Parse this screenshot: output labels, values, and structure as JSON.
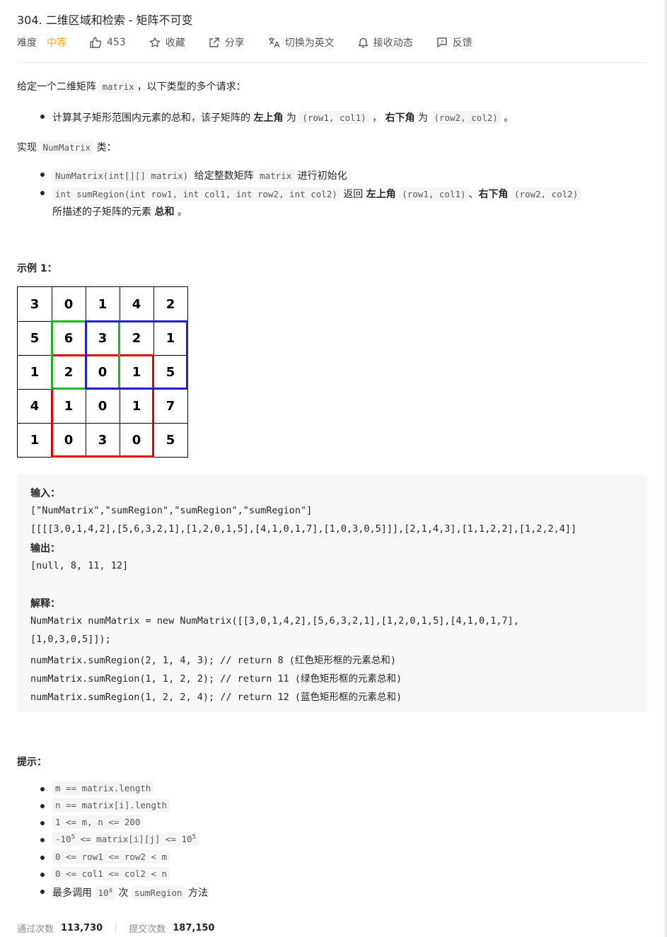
{
  "problem": {
    "title": "304. 二维区域和检索 - 矩阵不可变",
    "difficulty_label": "难度",
    "difficulty": "中等",
    "likes": "453",
    "favorite": "收藏",
    "share": "分享",
    "switch_lang": "切换为英文",
    "notify": "接收动态",
    "feedback": "反馈"
  },
  "colors": {
    "accent": "#ffa116",
    "red": "#e60000",
    "green": "#22b522",
    "blue": "#1f1fd0"
  },
  "desc": {
    "intro_a": "给定一个二维矩阵",
    "intro_code": "matrix",
    "intro_b": "，以下类型的多个请求：",
    "bullet1_a": "计算其子矩形范围内元素的总和，该子矩阵的",
    "bullet1_b1": "左上角",
    "bullet1_c": "为",
    "bullet1_code1": "(row1,  col1)",
    "bullet1_d": "，",
    "bullet1_b2": "右下角",
    "bullet1_e": "为",
    "bullet1_code2": "(row2,  col2)",
    "bullet1_f": "。",
    "impl_a": "实现",
    "impl_code": "NumMatrix",
    "impl_b": "类：",
    "m1_code": "NumMatrix(int[][] matrix)",
    "m1_text": "给定整数矩阵",
    "m1_code2": "matrix",
    "m1_text2": "进行初始化",
    "m2_code": "int sumRegion(int row1, int col1, int row2, int col2)",
    "m2_text": "返回",
    "m2_b1": "左上角",
    "m2_code2": "(row1,  col1)",
    "m2_sep": "、",
    "m2_b2": "右下角",
    "m2_code3": "(row2,  col2)",
    "m2_line2a": "所描述的子矩阵的元素",
    "m2_line2b": "总和",
    "m2_line2c": "。"
  },
  "example": {
    "heading": "示例 1：",
    "matrix": [
      [
        3,
        0,
        1,
        4,
        2
      ],
      [
        5,
        6,
        3,
        2,
        1
      ],
      [
        1,
        2,
        0,
        1,
        5
      ],
      [
        4,
        1,
        0,
        1,
        7
      ],
      [
        1,
        0,
        3,
        0,
        5
      ]
    ],
    "input_label": "输入：",
    "input_line1": "[\"NumMatrix\",\"sumRegion\",\"sumRegion\",\"sumRegion\"]",
    "input_line2": "[[[[3,0,1,4,2],[5,6,3,2,1],[1,2,0,1,5],[4,1,0,1,7],[1,0,3,0,5]]],[2,1,4,3],[1,1,2,2],[1,2,2,4]]",
    "output_label": "输出：",
    "output_line": "[null, 8, 11, 12]",
    "explain_label": "解释：",
    "explain_1": "NumMatrix numMatrix = new NumMatrix([[3,0,1,4,2],[5,6,3,2,1],[1,2,0,1,5],[4,1,0,1,7],",
    "explain_2": "[1,0,3,0,5]]);",
    "explain_3": "numMatrix.sumRegion(2, 1, 4, 3); // return 8 (红色矩形框的元素总和)",
    "explain_4": "numMatrix.sumRegion(1, 1, 2, 2); // return 11 (绿色矩形框的元素总和)",
    "explain_5": "numMatrix.sumRegion(1, 2, 2, 4); // return 12 (蓝色矩形框的元素总和)"
  },
  "hints": {
    "heading": "提示：",
    "h1": "m == matrix.length",
    "h2": "n == matrix[i].length",
    "h3": "1 <= m,  n <=  200",
    "h4a": "-10",
    "h4sup": "5",
    "h4b": "  <= matrix[i][j] <= 10",
    "h4sup2": "5",
    "h5": "0 <= row1 <= row2 < m",
    "h6": "0 <= col1 <= col2 < n",
    "h7a": "最多调用",
    "h7code": "10",
    "h7sup": "4",
    "h7b": "次",
    "h7code2": "sumRegion",
    "h7c": "方法"
  },
  "stats": {
    "accepted_label": "通过次数",
    "accepted": "113,730",
    "submitted_label": "提交次数",
    "submitted": "187,150"
  }
}
